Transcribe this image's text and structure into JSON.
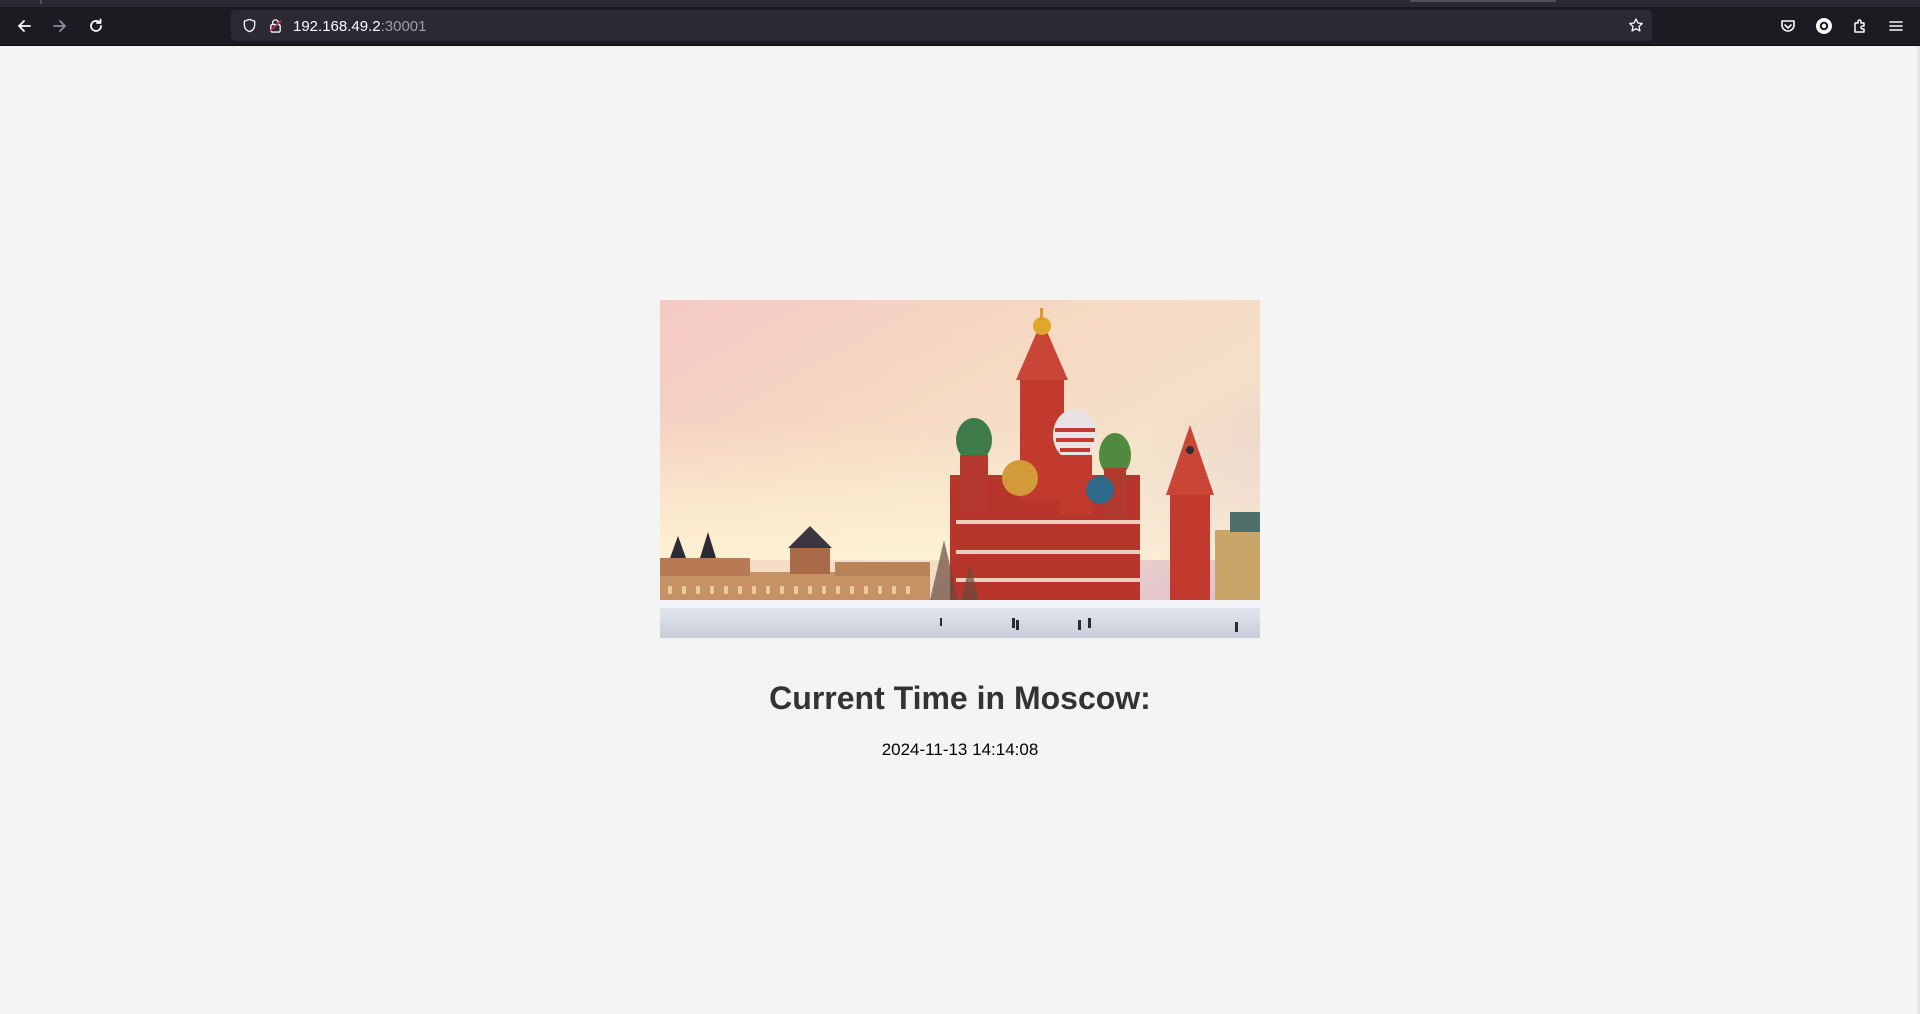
{
  "browser": {
    "url_host": "192.168.49.2",
    "url_port": ":30001",
    "icons": {
      "back": "back-arrow-icon",
      "forward": "forward-arrow-icon",
      "reload": "reload-icon",
      "shield": "tracking-protection-shield-icon",
      "lock": "insecure-lock-icon",
      "bookmark": "star-icon",
      "pocket": "pocket-icon",
      "account": "account-icon",
      "extensions": "extensions-icon",
      "menu": "hamburger-menu-icon"
    },
    "colors": {
      "chrome_bg": "#1c1b22",
      "urlbar_bg": "#2b2a33",
      "url_text": "#fbfbfe"
    }
  },
  "page": {
    "hero_image": "saint-basils-cathedral-red-square-winter",
    "heading": "Current Time in Moscow:",
    "time": "2024-11-13 14:14:08",
    "colors": {
      "background": "#f4f4f4",
      "heading": "#333333"
    }
  }
}
